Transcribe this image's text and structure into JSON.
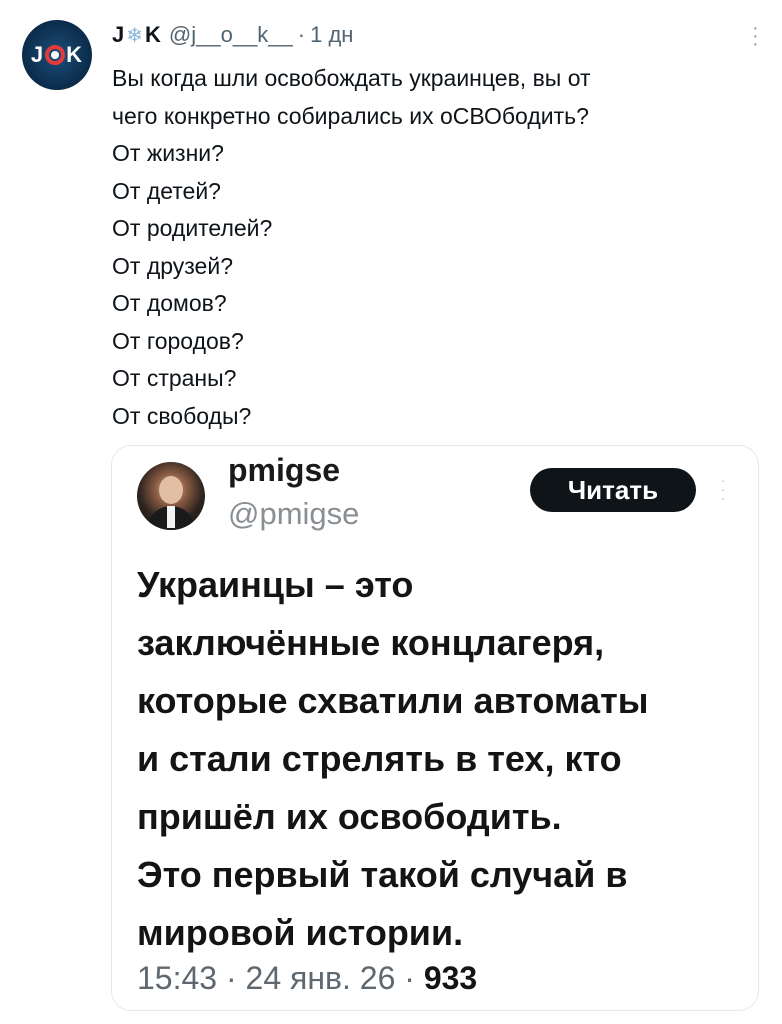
{
  "tweet": {
    "avatar_text_left": "J",
    "avatar_text_right": "K",
    "author_name_left": "J",
    "author_name_right": "K",
    "author_handle": "@j__o__k__",
    "separator": "·",
    "time_ago": "1 дн",
    "lines": [
      "Вы когда шли освобождать украинцев, вы от",
      "чего конкретно собирались их оСВОбодить?",
      "От жизни?",
      "От детей?",
      "От родителей?",
      "От друзей?",
      "От домов?",
      "От городов?",
      "От  страны?",
      "От свободы?"
    ]
  },
  "quote": {
    "name": "pmigse",
    "handle": "@pmigse",
    "follow_label": "Читать",
    "lines": [
      "Украинцы – это",
      "заключённые концлагеря,",
      "которые схватили автоматы",
      "и стали стрелять в тех, кто",
      "пришёл их освободить.",
      "Это первый такой случай в",
      "мировой истории."
    ],
    "time": "15:43",
    "date": "24 янв. 26",
    "views": "933",
    "separator": "·"
  },
  "icons": {
    "more": "more-vertical-icon",
    "snowflake": "snowflake-icon",
    "lifebuoy": "lifebuoy-icon"
  },
  "colors": {
    "accent_dark": "#0f1419",
    "muted": "#536471",
    "lifebuoy_red": "#e23b3b"
  }
}
